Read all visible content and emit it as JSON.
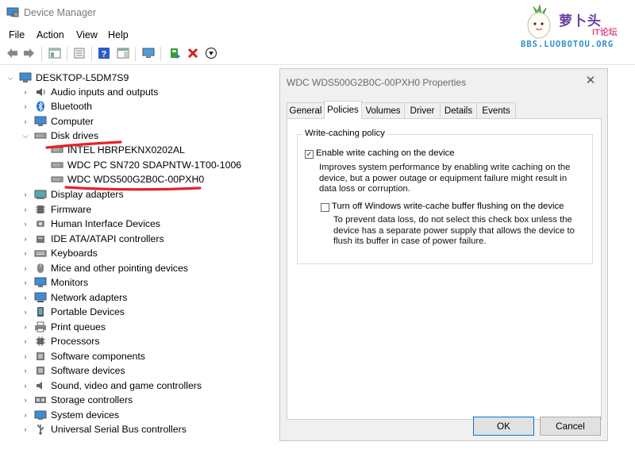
{
  "window": {
    "title": "Device Manager"
  },
  "watermark": {
    "chinese": "萝卜头",
    "sub": "IT论坛",
    "url": "BBS.LUOBOTOU.ORG"
  },
  "menu": [
    "File",
    "Action",
    "View",
    "Help"
  ],
  "tree": {
    "root": "DESKTOP-L5DM7S9",
    "categories": [
      {
        "label": "Audio inputs and outputs",
        "icon": "speaker-icon"
      },
      {
        "label": "Bluetooth",
        "icon": "bluetooth-icon"
      },
      {
        "label": "Computer",
        "icon": "monitor-icon"
      },
      {
        "label": "Disk drives",
        "icon": "disk-drive-icon",
        "expanded": true,
        "children": [
          "INTEL HBRPEKNX0202AL",
          "WDC PC SN720 SDAPNTW-1T00-1006",
          "WDC WDS500G2B0C-00PXH0"
        ]
      },
      {
        "label": "Display adapters",
        "icon": "display-adapter-icon"
      },
      {
        "label": "Firmware",
        "icon": "firmware-icon"
      },
      {
        "label": "Human Interface Devices",
        "icon": "hid-icon"
      },
      {
        "label": "IDE ATA/ATAPI controllers",
        "icon": "ide-controller-icon"
      },
      {
        "label": "Keyboards",
        "icon": "keyboard-icon"
      },
      {
        "label": "Mice and other pointing devices",
        "icon": "mouse-icon"
      },
      {
        "label": "Monitors",
        "icon": "monitor-icon"
      },
      {
        "label": "Network adapters",
        "icon": "network-adapter-icon"
      },
      {
        "label": "Portable Devices",
        "icon": "portable-device-icon"
      },
      {
        "label": "Print queues",
        "icon": "printer-icon"
      },
      {
        "label": "Processors",
        "icon": "processor-icon"
      },
      {
        "label": "Software components",
        "icon": "software-component-icon"
      },
      {
        "label": "Software devices",
        "icon": "software-device-icon"
      },
      {
        "label": "Sound, video and game controllers",
        "icon": "sound-icon"
      },
      {
        "label": "Storage controllers",
        "icon": "storage-controller-icon"
      },
      {
        "label": "System devices",
        "icon": "system-device-icon"
      },
      {
        "label": "Universal Serial Bus controllers",
        "icon": "usb-icon"
      }
    ]
  },
  "dialog": {
    "title": "WDC WDS500G2B0C-00PXH0 Properties",
    "tabs": [
      "General",
      "Policies",
      "Volumes",
      "Driver",
      "Details",
      "Events"
    ],
    "active_tab": "Policies",
    "group_title": "Write-caching policy",
    "option1": {
      "label": "Enable write caching on the device",
      "checked": true,
      "description": "Improves system performance by enabling write caching on the device, but a power outage or equipment failure might result in data loss or corruption."
    },
    "option2": {
      "label": "Turn off Windows write-cache buffer flushing on the device",
      "checked": false,
      "description": "To prevent data loss, do not select this check box unless the device has a separate power supply that allows the device to flush its buffer in case of power failure."
    },
    "ok_label": "OK",
    "cancel_label": "Cancel"
  },
  "colors": {
    "annotation_red": "#e8202a",
    "accent": "#0078d7"
  }
}
